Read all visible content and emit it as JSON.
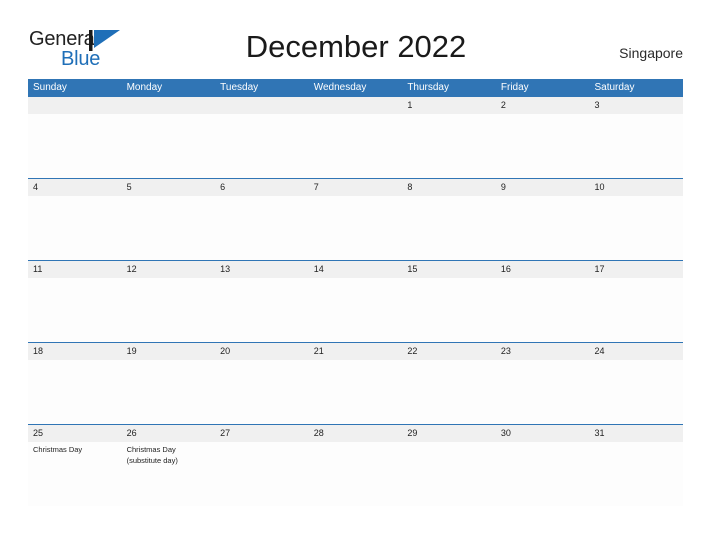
{
  "brand": {
    "name_part1": "General",
    "name_part2": "Blue",
    "logo_icon": "blue-flag-triangle-icon",
    "color_dark": "#222222",
    "color_blue": "#1f6fb8"
  },
  "header": {
    "title": "December 2022",
    "country": "Singapore"
  },
  "calendar": {
    "header_bg": "#3075b5",
    "band_bg": "#f0f0f0",
    "weekdays": [
      "Sunday",
      "Monday",
      "Tuesday",
      "Wednesday",
      "Thursday",
      "Friday",
      "Saturday"
    ],
    "weeks": [
      {
        "dates": [
          "",
          "",
          "",
          "",
          "1",
          "2",
          "3"
        ],
        "events": [
          "",
          "",
          "",
          "",
          "",
          "",
          ""
        ]
      },
      {
        "dates": [
          "4",
          "5",
          "6",
          "7",
          "8",
          "9",
          "10"
        ],
        "events": [
          "",
          "",
          "",
          "",
          "",
          "",
          ""
        ]
      },
      {
        "dates": [
          "11",
          "12",
          "13",
          "14",
          "15",
          "16",
          "17"
        ],
        "events": [
          "",
          "",
          "",
          "",
          "",
          "",
          ""
        ]
      },
      {
        "dates": [
          "18",
          "19",
          "20",
          "21",
          "22",
          "23",
          "24"
        ],
        "events": [
          "",
          "",
          "",
          "",
          "",
          "",
          ""
        ]
      },
      {
        "dates": [
          "25",
          "26",
          "27",
          "28",
          "29",
          "30",
          "31"
        ],
        "events": [
          "Christmas Day",
          "Christmas Day\n(substitute day)",
          "",
          "",
          "",
          "",
          ""
        ]
      }
    ]
  }
}
